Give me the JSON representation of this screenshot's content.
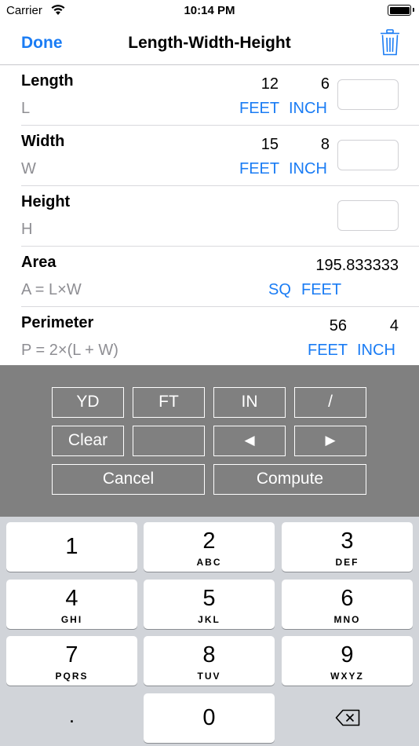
{
  "status_bar": {
    "carrier": "Carrier",
    "time": "10:14 PM"
  },
  "nav": {
    "done_label": "Done",
    "title": "Length-Width-Height",
    "trash_icon": "trash-icon"
  },
  "rows": {
    "length": {
      "label": "Length",
      "symbol": "L",
      "feet": "12",
      "inch": "6",
      "feet_unit": "FEET",
      "inch_unit": "INCH"
    },
    "width": {
      "label": "Width",
      "symbol": "W",
      "feet": "15",
      "inch": "8",
      "feet_unit": "FEET",
      "inch_unit": "INCH"
    },
    "height": {
      "label": "Height",
      "symbol": "H"
    },
    "area": {
      "label": "Area",
      "formula": "A = L×W",
      "value": "195.833333",
      "unit_sq": "SQ",
      "unit_feet": "FEET"
    },
    "perimeter": {
      "label": "Perimeter",
      "formula": "P = 2×(L + W)",
      "feet": "56",
      "inch": "4",
      "feet_unit": "FEET",
      "inch_unit": "INCH"
    }
  },
  "keypad": {
    "yd": "YD",
    "ft": "FT",
    "in": "IN",
    "slash": "/",
    "clear": "Clear",
    "left": "◀",
    "right": "▶",
    "cancel": "Cancel",
    "compute": "Compute"
  },
  "keyboard": {
    "keys": [
      {
        "num": "1",
        "letters": ""
      },
      {
        "num": "2",
        "letters": "ABC"
      },
      {
        "num": "3",
        "letters": "DEF"
      },
      {
        "num": "4",
        "letters": "GHI"
      },
      {
        "num": "5",
        "letters": "JKL"
      },
      {
        "num": "6",
        "letters": "MNO"
      },
      {
        "num": "7",
        "letters": "PQRS"
      },
      {
        "num": "8",
        "letters": "TUV"
      },
      {
        "num": "9",
        "letters": "WXYZ"
      }
    ],
    "dot": ".",
    "zero": "0",
    "delete_icon": "backspace-icon"
  },
  "colors": {
    "accent": "#1a7cf4",
    "keypad_bg": "#808080",
    "keyboard_bg": "#d1d4d9"
  }
}
